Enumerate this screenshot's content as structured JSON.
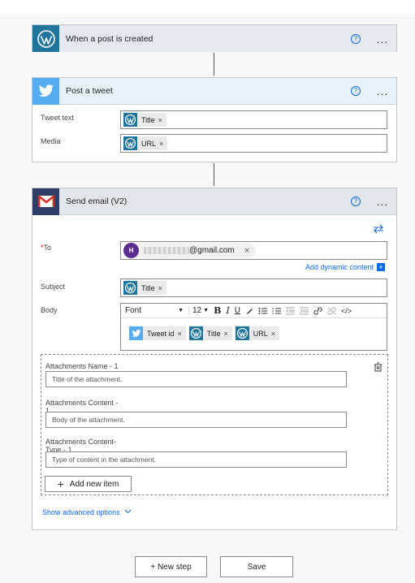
{
  "colors": {
    "wordpress": "#21759b",
    "twitter": "#55acee",
    "gmail_header": "#2f3e66",
    "accent_link": "#0b6ae0",
    "header_bg": "#e4e9f2"
  },
  "step1": {
    "title": "When a post is created",
    "help_icon": "help-icon",
    "more": "..."
  },
  "step2": {
    "title": "Post a tweet",
    "fields": [
      {
        "label": "Tweet text",
        "token": "Title"
      },
      {
        "label": "Media",
        "token": "URL"
      }
    ]
  },
  "step3": {
    "title": "Send email (V2)",
    "to": {
      "label": "To",
      "required": "*",
      "avatar_initial": "H",
      "email_suffix": "@gmail.com"
    },
    "add_dynamic": "Add dynamic content",
    "subject": {
      "label": "Subject",
      "token": "Title"
    },
    "body": {
      "label": "Body",
      "toolbar": {
        "font": "Font",
        "size": "12"
      },
      "tokens": [
        {
          "label": "Tweet id",
          "source": "twitter"
        },
        {
          "label": "Title",
          "source": "wordpress"
        },
        {
          "label": "URL",
          "source": "wordpress"
        }
      ]
    },
    "attachments": {
      "name_label": "Attachments Name - 1",
      "name_placeholder": "Title of the attachment.",
      "content_label_line1": "Attachments Content -",
      "content_label_line2": "1",
      "content_placeholder": "Body of the attachment.",
      "type_label_line1": "Attachments Content-",
      "type_label_line2": "Type - 1",
      "type_placeholder": "Type of content in the attachment.",
      "add_item": "Add new item"
    },
    "advanced": "Show advanced options"
  },
  "footer": {
    "new_step": "+ New step",
    "save": "Save"
  }
}
